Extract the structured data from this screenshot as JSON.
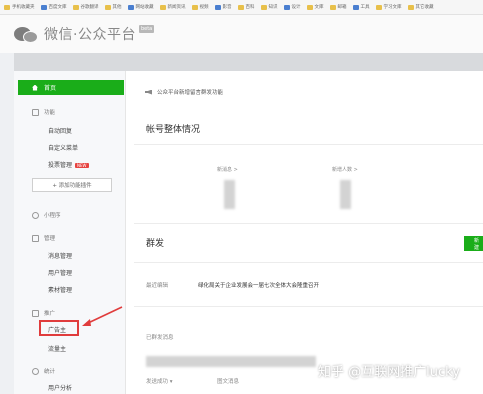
{
  "bookmarks": [
    "手机收藏夹",
    "百度文库",
    "谷歌翻译",
    "其他",
    "网站收藏",
    "新闻资讯",
    "视频",
    "影音",
    "百科",
    "知识",
    "设计",
    "文库",
    "邮箱",
    "工具",
    "学习文库",
    "其它收藏"
  ],
  "header": {
    "logo_text": "微信·公众平台",
    "logo_tag": "beta"
  },
  "sidebar": {
    "home": "首页",
    "features": {
      "title": "功能",
      "items": [
        "自动回复",
        "自定义菜单",
        "投票管理"
      ],
      "new_badge": "NEW",
      "add_button": "+ 添加功能插件"
    },
    "mini_program": "小程序",
    "manage": {
      "title": "管理",
      "items": [
        "消息管理",
        "用户管理",
        "素材管理"
      ]
    },
    "promote": {
      "title": "推广",
      "items": [
        "广告主",
        "流量主"
      ]
    },
    "stats": {
      "title": "统计",
      "items": [
        "用户分析"
      ]
    }
  },
  "main": {
    "notice": "公众平台新增留言群发功能",
    "account_title": "帐号整体情况",
    "stat1": "新消息 >",
    "stat2": "新增人数 >",
    "mass_title": "群发",
    "mass_button": "新建",
    "recent_label": "最近编辑",
    "recent_value": "绿化局关于企业发展会一届七次全体大会隆重召开",
    "sent_label": "已群发消息",
    "footer_left": "发送成功 ▾",
    "footer_right": "图文消息"
  },
  "watermark": "知乎 @互联网推广lucky",
  "colors": {
    "accent": "#1aad19",
    "highlight": "#e03c3c"
  }
}
